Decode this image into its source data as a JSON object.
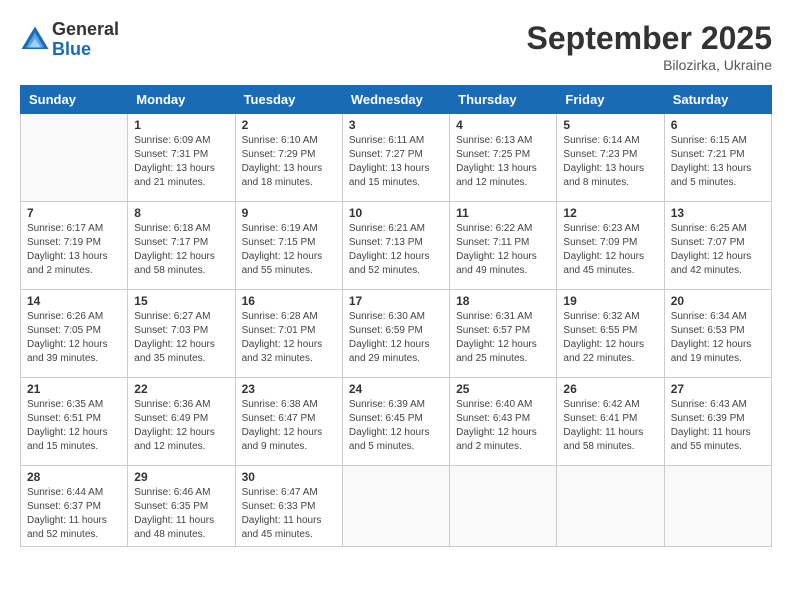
{
  "logo": {
    "general": "General",
    "blue": "Blue"
  },
  "title": "September 2025",
  "subtitle": "Bilozirka, Ukraine",
  "headers": [
    "Sunday",
    "Monday",
    "Tuesday",
    "Wednesday",
    "Thursday",
    "Friday",
    "Saturday"
  ],
  "weeks": [
    [
      {
        "day": null,
        "info": null
      },
      {
        "day": "1",
        "info": "Sunrise: 6:09 AM\nSunset: 7:31 PM\nDaylight: 13 hours\nand 21 minutes."
      },
      {
        "day": "2",
        "info": "Sunrise: 6:10 AM\nSunset: 7:29 PM\nDaylight: 13 hours\nand 18 minutes."
      },
      {
        "day": "3",
        "info": "Sunrise: 6:11 AM\nSunset: 7:27 PM\nDaylight: 13 hours\nand 15 minutes."
      },
      {
        "day": "4",
        "info": "Sunrise: 6:13 AM\nSunset: 7:25 PM\nDaylight: 13 hours\nand 12 minutes."
      },
      {
        "day": "5",
        "info": "Sunrise: 6:14 AM\nSunset: 7:23 PM\nDaylight: 13 hours\nand 8 minutes."
      },
      {
        "day": "6",
        "info": "Sunrise: 6:15 AM\nSunset: 7:21 PM\nDaylight: 13 hours\nand 5 minutes."
      }
    ],
    [
      {
        "day": "7",
        "info": "Sunrise: 6:17 AM\nSunset: 7:19 PM\nDaylight: 13 hours\nand 2 minutes."
      },
      {
        "day": "8",
        "info": "Sunrise: 6:18 AM\nSunset: 7:17 PM\nDaylight: 12 hours\nand 58 minutes."
      },
      {
        "day": "9",
        "info": "Sunrise: 6:19 AM\nSunset: 7:15 PM\nDaylight: 12 hours\nand 55 minutes."
      },
      {
        "day": "10",
        "info": "Sunrise: 6:21 AM\nSunset: 7:13 PM\nDaylight: 12 hours\nand 52 minutes."
      },
      {
        "day": "11",
        "info": "Sunrise: 6:22 AM\nSunset: 7:11 PM\nDaylight: 12 hours\nand 49 minutes."
      },
      {
        "day": "12",
        "info": "Sunrise: 6:23 AM\nSunset: 7:09 PM\nDaylight: 12 hours\nand 45 minutes."
      },
      {
        "day": "13",
        "info": "Sunrise: 6:25 AM\nSunset: 7:07 PM\nDaylight: 12 hours\nand 42 minutes."
      }
    ],
    [
      {
        "day": "14",
        "info": "Sunrise: 6:26 AM\nSunset: 7:05 PM\nDaylight: 12 hours\nand 39 minutes."
      },
      {
        "day": "15",
        "info": "Sunrise: 6:27 AM\nSunset: 7:03 PM\nDaylight: 12 hours\nand 35 minutes."
      },
      {
        "day": "16",
        "info": "Sunrise: 6:28 AM\nSunset: 7:01 PM\nDaylight: 12 hours\nand 32 minutes."
      },
      {
        "day": "17",
        "info": "Sunrise: 6:30 AM\nSunset: 6:59 PM\nDaylight: 12 hours\nand 29 minutes."
      },
      {
        "day": "18",
        "info": "Sunrise: 6:31 AM\nSunset: 6:57 PM\nDaylight: 12 hours\nand 25 minutes."
      },
      {
        "day": "19",
        "info": "Sunrise: 6:32 AM\nSunset: 6:55 PM\nDaylight: 12 hours\nand 22 minutes."
      },
      {
        "day": "20",
        "info": "Sunrise: 6:34 AM\nSunset: 6:53 PM\nDaylight: 12 hours\nand 19 minutes."
      }
    ],
    [
      {
        "day": "21",
        "info": "Sunrise: 6:35 AM\nSunset: 6:51 PM\nDaylight: 12 hours\nand 15 minutes."
      },
      {
        "day": "22",
        "info": "Sunrise: 6:36 AM\nSunset: 6:49 PM\nDaylight: 12 hours\nand 12 minutes."
      },
      {
        "day": "23",
        "info": "Sunrise: 6:38 AM\nSunset: 6:47 PM\nDaylight: 12 hours\nand 9 minutes."
      },
      {
        "day": "24",
        "info": "Sunrise: 6:39 AM\nSunset: 6:45 PM\nDaylight: 12 hours\nand 5 minutes."
      },
      {
        "day": "25",
        "info": "Sunrise: 6:40 AM\nSunset: 6:43 PM\nDaylight: 12 hours\nand 2 minutes."
      },
      {
        "day": "26",
        "info": "Sunrise: 6:42 AM\nSunset: 6:41 PM\nDaylight: 11 hours\nand 58 minutes."
      },
      {
        "day": "27",
        "info": "Sunrise: 6:43 AM\nSunset: 6:39 PM\nDaylight: 11 hours\nand 55 minutes."
      }
    ],
    [
      {
        "day": "28",
        "info": "Sunrise: 6:44 AM\nSunset: 6:37 PM\nDaylight: 11 hours\nand 52 minutes."
      },
      {
        "day": "29",
        "info": "Sunrise: 6:46 AM\nSunset: 6:35 PM\nDaylight: 11 hours\nand 48 minutes."
      },
      {
        "day": "30",
        "info": "Sunrise: 6:47 AM\nSunset: 6:33 PM\nDaylight: 11 hours\nand 45 minutes."
      },
      {
        "day": null,
        "info": null
      },
      {
        "day": null,
        "info": null
      },
      {
        "day": null,
        "info": null
      },
      {
        "day": null,
        "info": null
      }
    ]
  ]
}
